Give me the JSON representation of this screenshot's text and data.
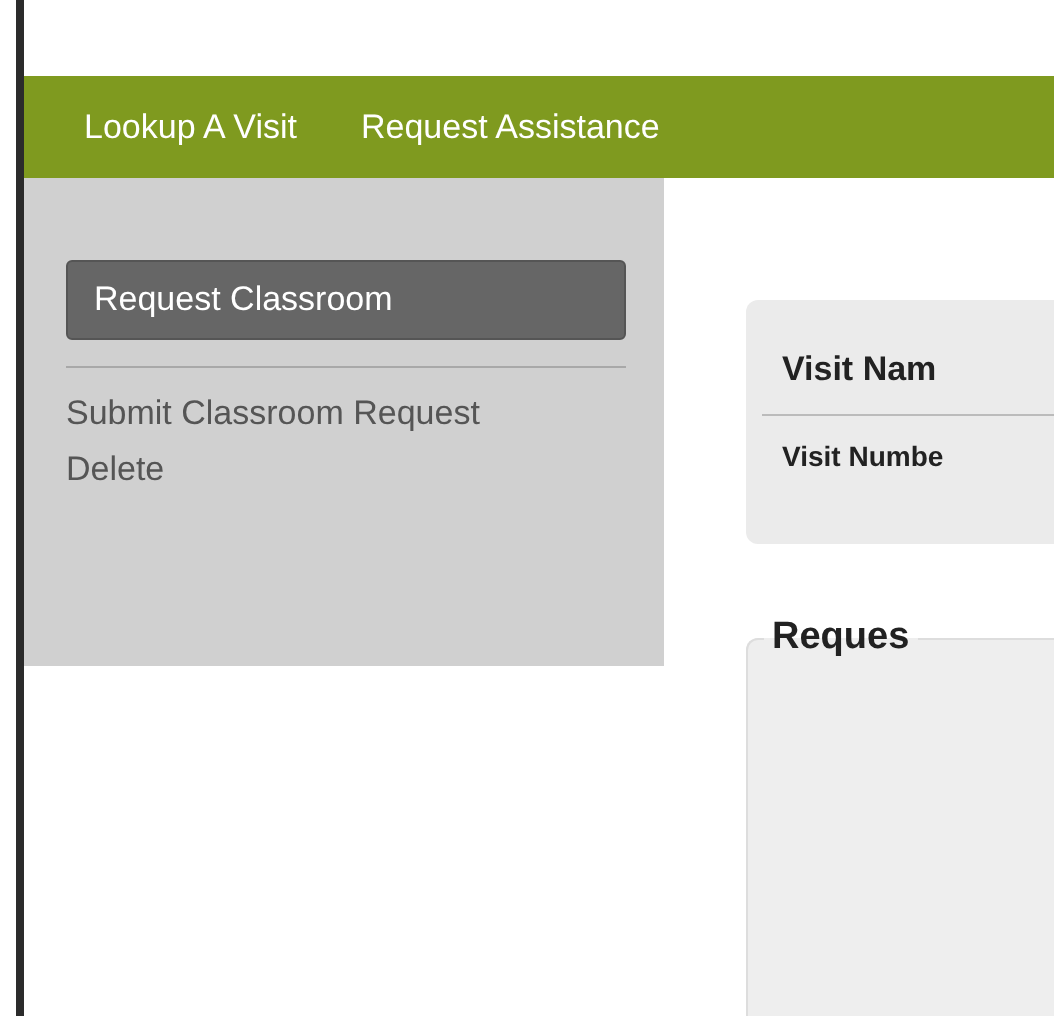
{
  "nav": [
    {
      "label": "Lookup A Visit"
    },
    {
      "label": "Request Assistance"
    }
  ],
  "sidebar": {
    "button": "Request Classroom",
    "items": [
      {
        "label": "Submit Classroom Request"
      },
      {
        "label": "Delete"
      }
    ]
  },
  "visit_card": {
    "name": "Visit Nam",
    "number": "Visit Numbe"
  },
  "request_panel": {
    "legend": "Reques"
  }
}
